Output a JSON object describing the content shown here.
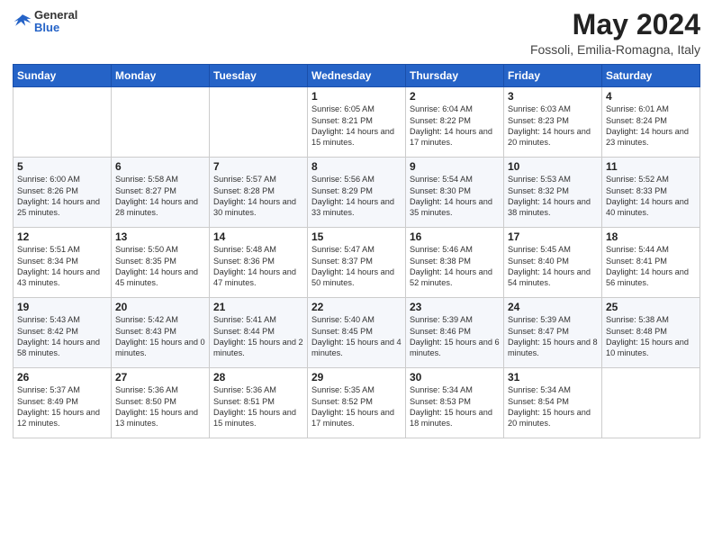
{
  "header": {
    "logo_general": "General",
    "logo_blue": "Blue",
    "month_title": "May 2024",
    "location": "Fossoli, Emilia-Romagna, Italy"
  },
  "weekdays": [
    "Sunday",
    "Monday",
    "Tuesday",
    "Wednesday",
    "Thursday",
    "Friday",
    "Saturday"
  ],
  "weeks": [
    [
      {
        "day": "",
        "info": ""
      },
      {
        "day": "",
        "info": ""
      },
      {
        "day": "",
        "info": ""
      },
      {
        "day": "1",
        "info": "Sunrise: 6:05 AM\nSunset: 8:21 PM\nDaylight: 14 hours\nand 15 minutes."
      },
      {
        "day": "2",
        "info": "Sunrise: 6:04 AM\nSunset: 8:22 PM\nDaylight: 14 hours\nand 17 minutes."
      },
      {
        "day": "3",
        "info": "Sunrise: 6:03 AM\nSunset: 8:23 PM\nDaylight: 14 hours\nand 20 minutes."
      },
      {
        "day": "4",
        "info": "Sunrise: 6:01 AM\nSunset: 8:24 PM\nDaylight: 14 hours\nand 23 minutes."
      }
    ],
    [
      {
        "day": "5",
        "info": "Sunrise: 6:00 AM\nSunset: 8:26 PM\nDaylight: 14 hours\nand 25 minutes."
      },
      {
        "day": "6",
        "info": "Sunrise: 5:58 AM\nSunset: 8:27 PM\nDaylight: 14 hours\nand 28 minutes."
      },
      {
        "day": "7",
        "info": "Sunrise: 5:57 AM\nSunset: 8:28 PM\nDaylight: 14 hours\nand 30 minutes."
      },
      {
        "day": "8",
        "info": "Sunrise: 5:56 AM\nSunset: 8:29 PM\nDaylight: 14 hours\nand 33 minutes."
      },
      {
        "day": "9",
        "info": "Sunrise: 5:54 AM\nSunset: 8:30 PM\nDaylight: 14 hours\nand 35 minutes."
      },
      {
        "day": "10",
        "info": "Sunrise: 5:53 AM\nSunset: 8:32 PM\nDaylight: 14 hours\nand 38 minutes."
      },
      {
        "day": "11",
        "info": "Sunrise: 5:52 AM\nSunset: 8:33 PM\nDaylight: 14 hours\nand 40 minutes."
      }
    ],
    [
      {
        "day": "12",
        "info": "Sunrise: 5:51 AM\nSunset: 8:34 PM\nDaylight: 14 hours\nand 43 minutes."
      },
      {
        "day": "13",
        "info": "Sunrise: 5:50 AM\nSunset: 8:35 PM\nDaylight: 14 hours\nand 45 minutes."
      },
      {
        "day": "14",
        "info": "Sunrise: 5:48 AM\nSunset: 8:36 PM\nDaylight: 14 hours\nand 47 minutes."
      },
      {
        "day": "15",
        "info": "Sunrise: 5:47 AM\nSunset: 8:37 PM\nDaylight: 14 hours\nand 50 minutes."
      },
      {
        "day": "16",
        "info": "Sunrise: 5:46 AM\nSunset: 8:38 PM\nDaylight: 14 hours\nand 52 minutes."
      },
      {
        "day": "17",
        "info": "Sunrise: 5:45 AM\nSunset: 8:40 PM\nDaylight: 14 hours\nand 54 minutes."
      },
      {
        "day": "18",
        "info": "Sunrise: 5:44 AM\nSunset: 8:41 PM\nDaylight: 14 hours\nand 56 minutes."
      }
    ],
    [
      {
        "day": "19",
        "info": "Sunrise: 5:43 AM\nSunset: 8:42 PM\nDaylight: 14 hours\nand 58 minutes."
      },
      {
        "day": "20",
        "info": "Sunrise: 5:42 AM\nSunset: 8:43 PM\nDaylight: 15 hours\nand 0 minutes."
      },
      {
        "day": "21",
        "info": "Sunrise: 5:41 AM\nSunset: 8:44 PM\nDaylight: 15 hours\nand 2 minutes."
      },
      {
        "day": "22",
        "info": "Sunrise: 5:40 AM\nSunset: 8:45 PM\nDaylight: 15 hours\nand 4 minutes."
      },
      {
        "day": "23",
        "info": "Sunrise: 5:39 AM\nSunset: 8:46 PM\nDaylight: 15 hours\nand 6 minutes."
      },
      {
        "day": "24",
        "info": "Sunrise: 5:39 AM\nSunset: 8:47 PM\nDaylight: 15 hours\nand 8 minutes."
      },
      {
        "day": "25",
        "info": "Sunrise: 5:38 AM\nSunset: 8:48 PM\nDaylight: 15 hours\nand 10 minutes."
      }
    ],
    [
      {
        "day": "26",
        "info": "Sunrise: 5:37 AM\nSunset: 8:49 PM\nDaylight: 15 hours\nand 12 minutes."
      },
      {
        "day": "27",
        "info": "Sunrise: 5:36 AM\nSunset: 8:50 PM\nDaylight: 15 hours\nand 13 minutes."
      },
      {
        "day": "28",
        "info": "Sunrise: 5:36 AM\nSunset: 8:51 PM\nDaylight: 15 hours\nand 15 minutes."
      },
      {
        "day": "29",
        "info": "Sunrise: 5:35 AM\nSunset: 8:52 PM\nDaylight: 15 hours\nand 17 minutes."
      },
      {
        "day": "30",
        "info": "Sunrise: 5:34 AM\nSunset: 8:53 PM\nDaylight: 15 hours\nand 18 minutes."
      },
      {
        "day": "31",
        "info": "Sunrise: 5:34 AM\nSunset: 8:54 PM\nDaylight: 15 hours\nand 20 minutes."
      },
      {
        "day": "",
        "info": ""
      }
    ]
  ]
}
